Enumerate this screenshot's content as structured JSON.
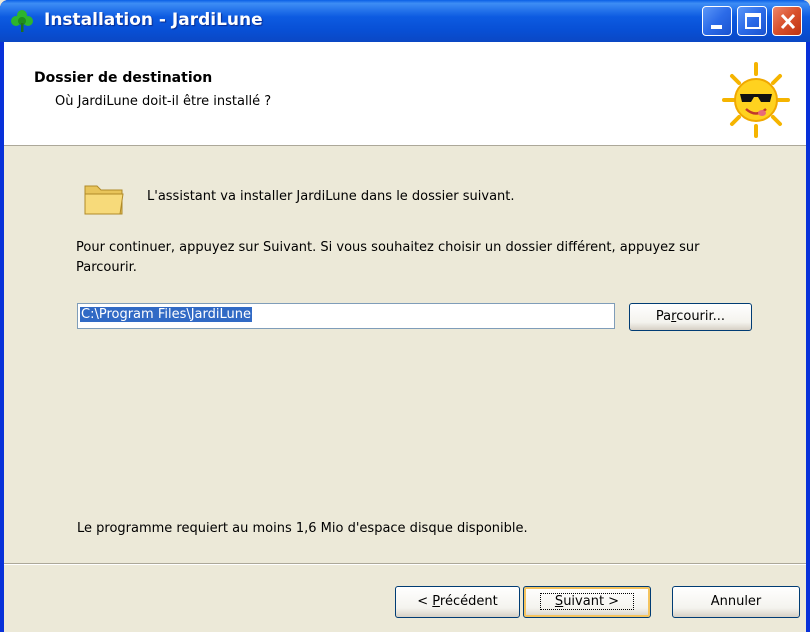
{
  "window": {
    "title": "Installation - JardiLune",
    "controls": {
      "minimize": "minimize-icon",
      "maximize": "maximize-icon",
      "close": "close-icon"
    }
  },
  "header": {
    "title": "Dossier de destination",
    "subtitle": "Où JardiLune doit-il être installé ?"
  },
  "body": {
    "intro": "L'assistant va installer JardiLune dans le dossier suivant.",
    "continue": "Pour continuer, appuyez sur Suivant. Si vous souhaitez choisir un dossier différent, appuyez sur Parcourir.",
    "path_value": "C:\\Program Files\\JardiLune",
    "browse": {
      "pre": "Pa",
      "accel": "r",
      "post": "courir..."
    },
    "space": "Le programme requiert au moins 1,6 Mio d'espace disque disponible."
  },
  "buttons": {
    "back": {
      "pre": "< ",
      "accel": "P",
      "post": "récédent"
    },
    "next": {
      "pre": "",
      "accel": "S",
      "post": "uivant >"
    },
    "cancel": "Annuler"
  },
  "colors": {
    "titlebar": "#0A5FE6",
    "dialog_bg": "#ECE9D8",
    "selection": "#316AC5",
    "default_button_focus": "#F5C45E"
  }
}
